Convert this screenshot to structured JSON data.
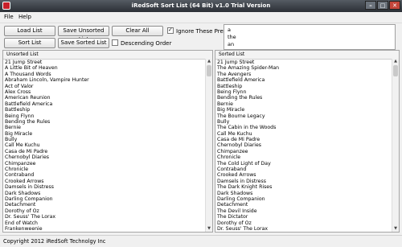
{
  "window": {
    "title": "iRedSoft Sort List (64 Bit) v1.0 Trial Version",
    "buttons": [
      "–",
      "□",
      "✕"
    ]
  },
  "menu": [
    "File",
    "Help"
  ],
  "toolbar": {
    "load_list": "Load List",
    "save_unsorted": "Save Unsorted List",
    "clear_all": "Clear All",
    "sort_list": "Sort List",
    "save_sorted": "Save Sorted List",
    "ignore_prefix_label": "Ignore These Prefix",
    "ignore_prefix_checked": true,
    "descending_label": "Descending Order",
    "descending_checked": false
  },
  "prefixes": [
    "a",
    "the",
    "an"
  ],
  "unsorted": {
    "header": "Unsorted List",
    "items": [
      "21 Jump Street",
      "A Little Bit of Heaven",
      "A Thousand Words",
      "Abraham Lincoln, Vampire Hunter",
      "Act of Valor",
      "Alex Cross",
      "American Reunion",
      "Battlefield America",
      "Battleship",
      "Being Flynn",
      "Bending the Rules",
      "Bernie",
      "Big Miracle",
      "Bully",
      "Call Me Kuchu",
      "Casa de Mi Padre",
      "Chernobyl Diaries",
      "Chimpanzee",
      "Chronicle",
      "Contraband",
      "Crooked Arrows",
      "Damsels in Distress",
      "Dark Shadows",
      "Darling Companion",
      "Detachment",
      "Dorothy of Oz",
      "Dr. Seuss' The Lorax",
      "End of Watch",
      "Frankenweenie"
    ]
  },
  "sorted": {
    "header": "Sorted List",
    "items": [
      "21 Jump Street",
      "The Amazing Spider-Man",
      "The Avengers",
      "Battlefield America",
      "Battleship",
      "Being Flynn",
      "Bending the Rules",
      "Bernie",
      "Big Miracle",
      "The Bourne Legacy",
      "Bully",
      "The Cabin in the Woods",
      "Call Me Kuchu",
      "Casa de Mi Padre",
      "Chernobyl Diaries",
      "Chimpanzee",
      "Chronicle",
      "The Cold Light of Day",
      "Contraband",
      "Crooked Arrows",
      "Damsels in Distress",
      "The Dark Knight Rises",
      "Dark Shadows",
      "Darling Companion",
      "Detachment",
      "The Devil Inside",
      "The Dictator",
      "Dorothy of Oz",
      "Dr. Seuss' The Lorax"
    ]
  },
  "status": "Copyright 2012 iRedSoft Technolgy Inc",
  "colors": {
    "titlebar": "#2b2f35",
    "panel_bg": "#ffffff",
    "window_bg": "#f0f0f0"
  }
}
